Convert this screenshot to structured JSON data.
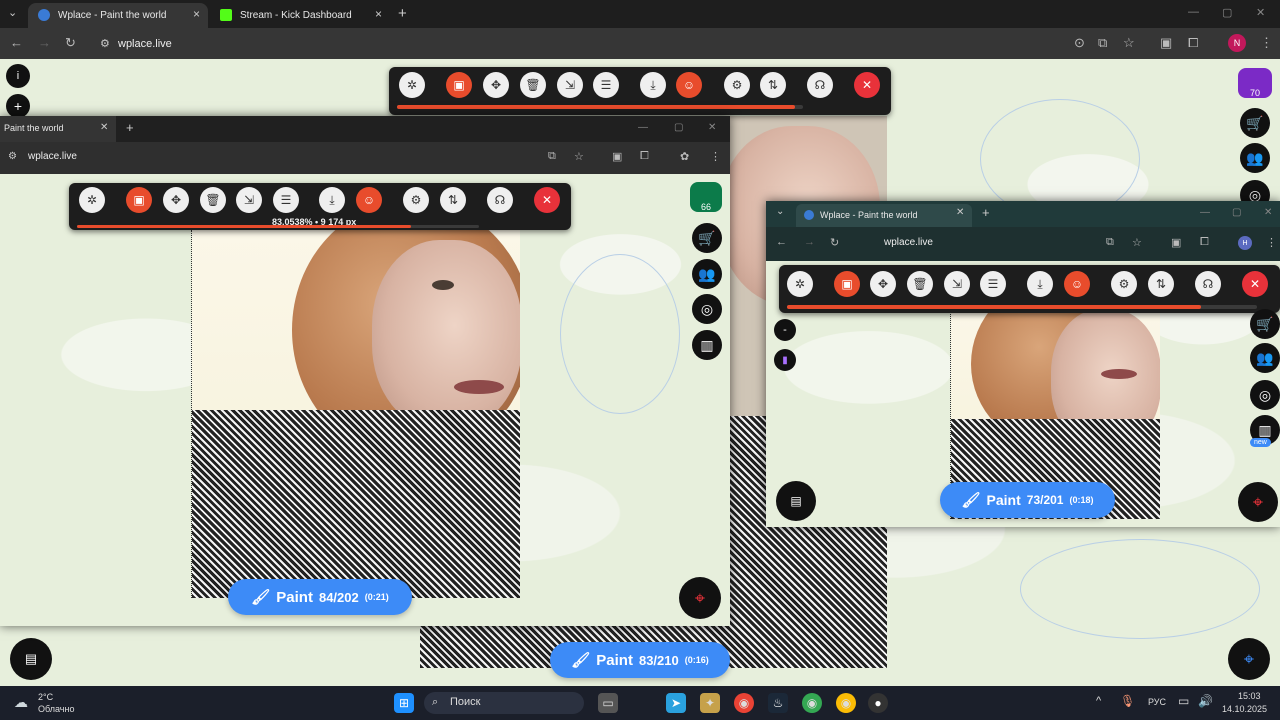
{
  "colors": {
    "accent_red": "#e84c2c",
    "paint_blue": "#3d8bf7",
    "map_bg": "#e7efdc"
  },
  "main_browser": {
    "tabs": [
      {
        "label": "Wplace - Paint the world",
        "icon": "globe-icon"
      },
      {
        "label": "Stream - Kick Dashboard",
        "icon": "kick-icon"
      }
    ],
    "url": "wplace.live"
  },
  "toolbar_icons": [
    "blueprint-icon",
    "image-icon",
    "move-icon",
    "trash-icon",
    "resize-icon",
    "layers-icon",
    "download-icon",
    "bot-icon",
    "gear-icon",
    "sort-icon",
    "discord-icon",
    "close-icon"
  ],
  "window_a": {
    "tab_label": "Paint the world",
    "url": "wplace.live",
    "progress_text": "83.0538% • 9 174 px",
    "progress_fraction": 0.83,
    "badge": "66",
    "paint": {
      "label": "Paint",
      "count": "84/202",
      "timer": "(0:21)"
    }
  },
  "window_b": {
    "tab_label": "Wplace - Paint the world",
    "url": "wplace.live",
    "progress_fraction": 0.88,
    "paint": {
      "label": "Paint",
      "count": "73/201",
      "timer": "(0:18)"
    },
    "new_label": "new"
  },
  "main_overlay": {
    "progress_fraction": 0.98,
    "badge": "70",
    "paint": {
      "label": "Paint",
      "count": "83/210",
      "timer": "(0:16)"
    }
  },
  "left_controls": {
    "info": "i",
    "zoom_in": "+",
    "zoom_out": "-"
  },
  "taskbar": {
    "weather_temp": "2°C",
    "weather_desc": "Облачно",
    "search": "Поиск",
    "lang": "РУС",
    "time": "15:03",
    "date": "14.10.2025"
  }
}
